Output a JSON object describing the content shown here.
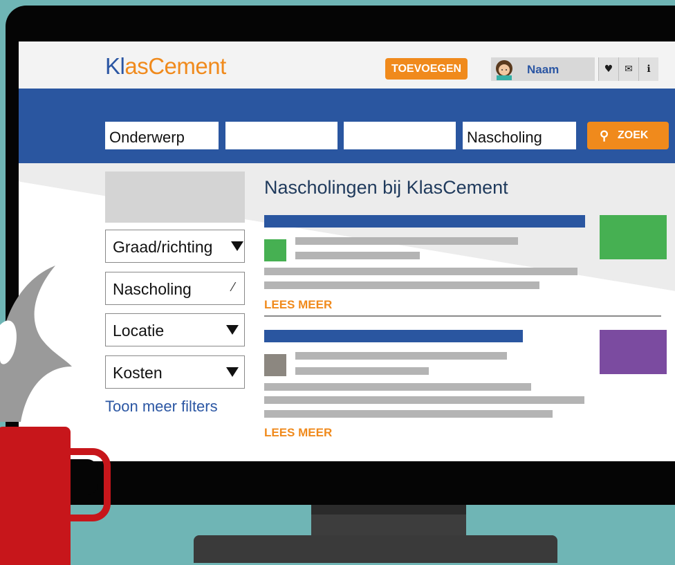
{
  "header": {
    "logo_prefix": "Kl",
    "logo_rest": "asCement",
    "add_button": "TOEVOEGEN",
    "user_name": "Naam",
    "icons": [
      "heart-icon",
      "mail-icon",
      "info-icon"
    ]
  },
  "search": {
    "field_1": "Onderwerp",
    "field_2": "",
    "field_3": "",
    "field_4": "Nascholing",
    "button_label": "ZOEK",
    "button_icon": "search-icon"
  },
  "sidebar": {
    "filters": [
      {
        "label": "Graad/richting",
        "control": "dropdown"
      },
      {
        "label": "Nascholing",
        "control": "edit"
      },
      {
        "label": "Locatie",
        "control": "dropdown"
      },
      {
        "label": "Kosten",
        "control": "dropdown"
      }
    ],
    "more_filters": "Toon meer filters"
  },
  "main": {
    "title": "Nascholingen bij KlasCement",
    "results": [
      {
        "thumbnail_color": "#46b052",
        "icon_color": "#46b052",
        "link": "LEES MEER"
      },
      {
        "thumbnail_color": "#7b4ba0",
        "icon_color": "#8c8780",
        "link": "LEES MEER"
      }
    ]
  },
  "colors": {
    "brand_blue": "#2a56a0",
    "brand_orange": "#f08a1c",
    "mug_red": "#c7161b",
    "wall_teal": "#6fb5b5"
  }
}
